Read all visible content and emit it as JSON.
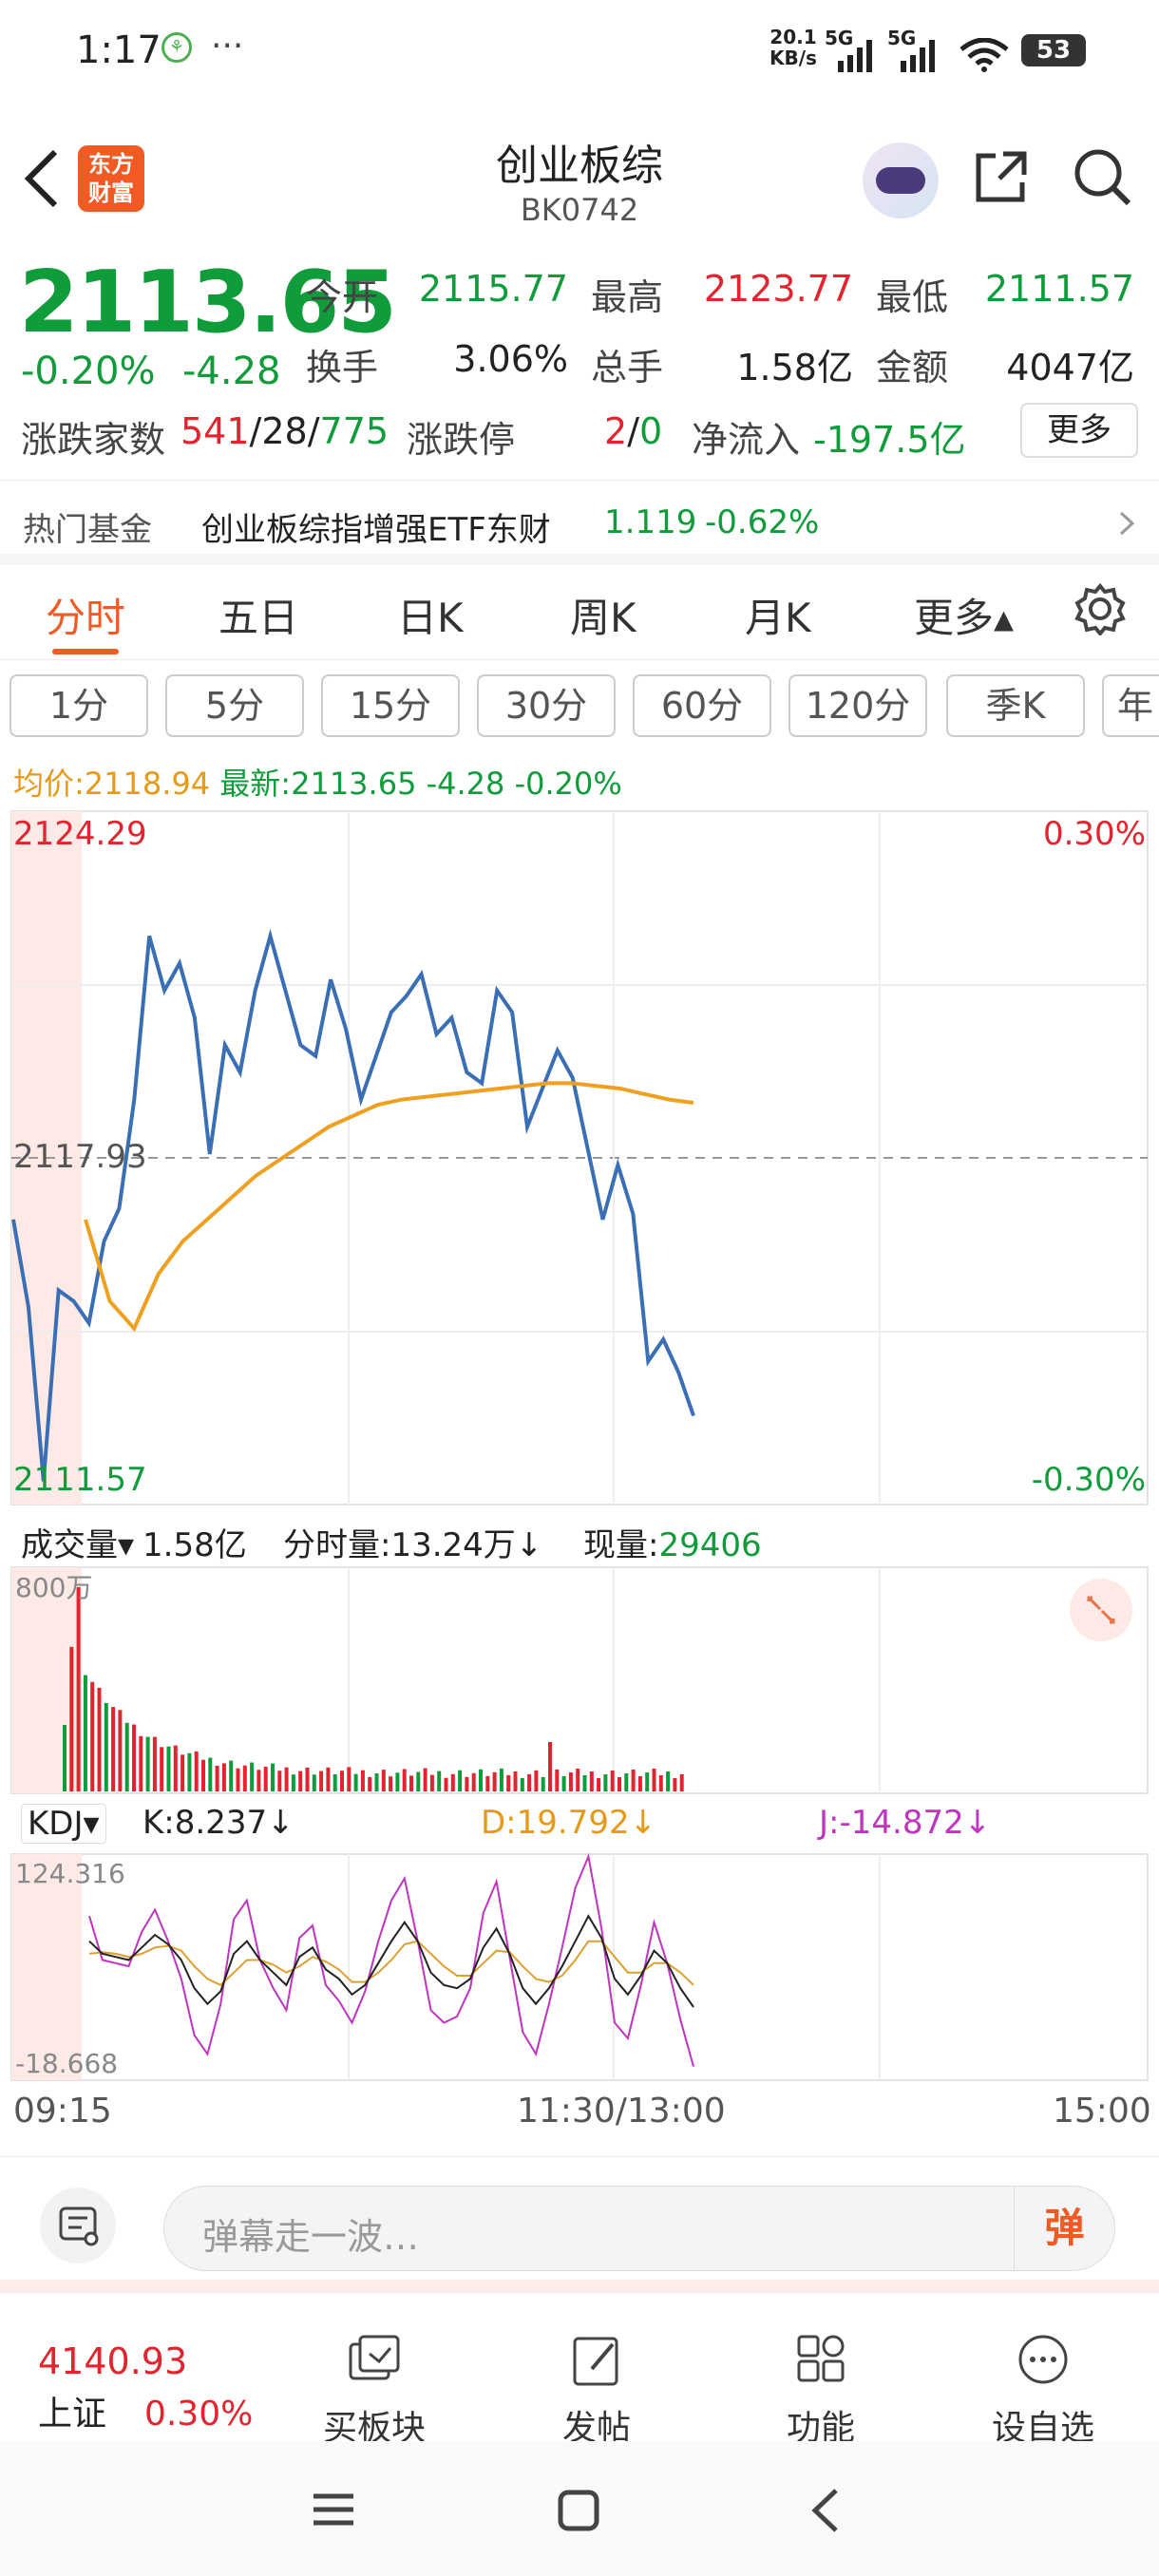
{
  "status_bar": {
    "time": "1:17",
    "dots": "···",
    "net_speed_top": "20.1",
    "net_speed_unit": "KB/s",
    "sig1": "5G",
    "sig2": "5G",
    "battery": "53"
  },
  "header": {
    "logo_line1": "东方",
    "logo_line2": "财富",
    "title": "创业板综",
    "code": "BK0742"
  },
  "quote": {
    "price": "2113.65",
    "change_pct": "-0.20%",
    "change": "-4.28",
    "open_label": "今开",
    "open": "2115.77",
    "high_label": "最高",
    "high": "2123.77",
    "low_label": "最低",
    "low": "2111.57",
    "turnover_label": "换手",
    "turnover": "3.06%",
    "volume_label": "总手",
    "volume": "1.58亿",
    "amount_label": "金额",
    "amount": "4047亿",
    "breadth_label": "涨跌家数",
    "breadth_up": "541",
    "sep1": "/",
    "breadth_flat": "28",
    "sep2": "/",
    "breadth_down": "775",
    "limit_label": "涨跌停",
    "limit_up": "2",
    "sep3": "/",
    "limit_down": "0",
    "netflow_label": "净流入",
    "netflow": "-197.5亿",
    "more": "更多"
  },
  "fund": {
    "label": "热门基金",
    "name": "创业板综指增强ETF东财",
    "price": "1.119",
    "change": "-0.62%"
  },
  "tabs": [
    "分时",
    "五日",
    "日K",
    "周K",
    "月K",
    "更多▴"
  ],
  "periods": [
    "1分",
    "5分",
    "15分",
    "30分",
    "60分",
    "120分",
    "季K",
    "年"
  ],
  "avg_line": {
    "avg_label": "均价:",
    "avg": "2118.94",
    "latest_label": "最新:",
    "latest": "2113.65",
    "change": "-4.28",
    "pct": "-0.20%"
  },
  "main_chart_labels": {
    "top_price": "2124.29",
    "mid_price": "2117.93",
    "bottom_price": "2111.57",
    "top_pct": "0.30%",
    "bottom_pct": "-0.30%"
  },
  "volume_row": {
    "selector": "成交量▾",
    "total": "1.58亿",
    "tick_label": "分时量:13.24万↓",
    "now_label": "现量:",
    "now": "29406",
    "scale": "800万"
  },
  "kdj_row": {
    "selector": "KDJ▾",
    "k": "K:8.237↓",
    "d": "D:19.792↓",
    "j": "J:-14.872↓",
    "top": "124.316",
    "bottom": "-18.668"
  },
  "time_axis": [
    "09:15",
    "11:30/13:00",
    "15:00"
  ],
  "danmu": {
    "placeholder": "弹幕走一波…",
    "button": "弹"
  },
  "bottom_bar": {
    "index_value": "4140.93",
    "index_name": "上证",
    "index_pct": "0.30%",
    "items": [
      "买板块",
      "发帖",
      "功能",
      "设自选"
    ]
  },
  "colors": {
    "up": "#e3232d",
    "down": "#109c3a",
    "brand": "#f15a22",
    "price_line": "#3a6fb5",
    "avg_line": "#f0a020"
  },
  "chart_data": {
    "type": "line",
    "ylim": [
      2111.57,
      2124.29
    ],
    "base": 2117.93,
    "series": [
      {
        "values": [
          2116.8,
          2115.2,
          2112.0,
          2115.5,
          2115.3,
          2114.9,
          2116.4,
          2117.0,
          2119.0,
          2122.0,
          2121.0,
          2121.5,
          2120.5,
          2118.0,
          2120.0,
          2119.5,
          2121.0,
          2122.0,
          2121.0,
          2120.0,
          2119.8,
          2121.2,
          2120.3,
          2119.0,
          2119.8,
          2120.6,
          2120.9,
          2121.3,
          2120.2,
          2120.5,
          2119.5,
          2119.3,
          2121.0,
          2120.6,
          2118.5,
          2119.2,
          2119.9,
          2119.4,
          2118.1,
          2116.8,
          2117.8,
          2116.9,
          2114.2,
          2114.6,
          2114.0,
          2113.2
        ]
      },
      {
        "values": [
          2116.8,
          2115.3,
          2114.8,
          2115.8,
          2116.4,
          2116.8,
          2117.2,
          2117.6,
          2117.9,
          2118.2,
          2118.5,
          2118.7,
          2118.9,
          2119.0,
          2119.05,
          2119.1,
          2119.15,
          2119.2,
          2119.25,
          2119.3,
          2119.3,
          2119.25,
          2119.2,
          2119.1,
          2119.0,
          2118.94
        ]
      }
    ]
  },
  "kdj_data": {
    "ylim": [
      -18.668,
      124.316
    ],
    "k": [
      70,
      62,
      60,
      58,
      66,
      74,
      68,
      58,
      40,
      30,
      38,
      62,
      70,
      58,
      50,
      42,
      60,
      66,
      52,
      46,
      36,
      42,
      56,
      70,
      82,
      70,
      50,
      42,
      40,
      46,
      66,
      78,
      62,
      40,
      30,
      40,
      54,
      70,
      86,
      72,
      46,
      36,
      48,
      64,
      56,
      40,
      28
    ],
    "d": [
      62,
      63,
      62,
      60,
      62,
      66,
      67,
      64,
      54,
      46,
      42,
      50,
      58,
      58,
      55,
      50,
      54,
      60,
      57,
      52,
      44,
      44,
      50,
      58,
      68,
      70,
      62,
      54,
      48,
      48,
      56,
      64,
      63,
      54,
      46,
      44,
      48,
      58,
      70,
      70,
      60,
      50,
      50,
      56,
      56,
      50,
      42
    ],
    "j": [
      86,
      58,
      56,
      54,
      76,
      90,
      70,
      46,
      10,
      -2,
      30,
      84,
      96,
      58,
      40,
      26,
      72,
      80,
      42,
      32,
      18,
      38,
      70,
      96,
      110,
      70,
      26,
      18,
      22,
      40,
      88,
      108,
      60,
      12,
      -2,
      30,
      66,
      104,
      124,
      78,
      18,
      8,
      42,
      82,
      56,
      20,
      -10
    ]
  }
}
